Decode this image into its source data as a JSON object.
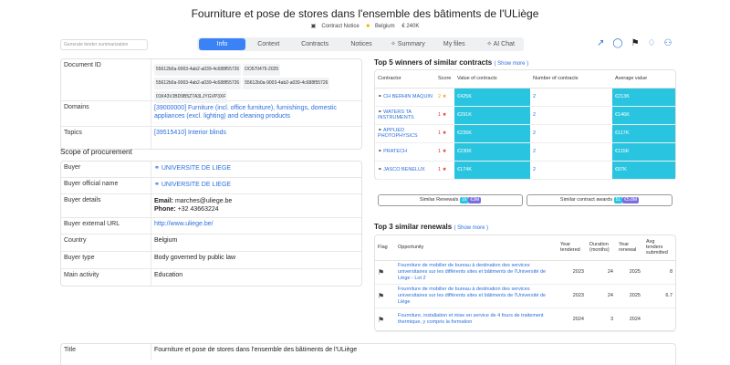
{
  "header": {
    "title": "Fourniture et pose de stores dans l'ensemble des bâtiments de l'ULiège",
    "notice_type": "Contract Notice",
    "country": "Belgium",
    "value": "€ 240K"
  },
  "search": {
    "placeholder": "Generate tender summarization"
  },
  "tabs": [
    {
      "label": "Info",
      "active": true
    },
    {
      "label": "Context"
    },
    {
      "label": "Contracts"
    },
    {
      "label": "Notices"
    },
    {
      "label": "Summary",
      "icon": "sparkle-icon"
    },
    {
      "label": "My files"
    },
    {
      "label": "AI Chat",
      "icon": "sparkle-icon"
    }
  ],
  "toolbar_icons": [
    "share-icon",
    "comment-icon",
    "flag-icon",
    "bell-icon",
    "add-user-icon"
  ],
  "details": {
    "document_id": {
      "label": "Document ID",
      "chips": [
        "55612b0a-9003-4ab2-a039-4c688f55726",
        "DO570475-2025",
        "55612b0a-9003-4ab2-a039-4c688f55726",
        "55612b0a-9003-4ab2-a039-4c688f55726",
        "01K43VJBD9B5Z7A3LJYGVP3XF"
      ]
    },
    "domains": {
      "label": "Domains",
      "value": "[39000000] Furniture (incl. office furniture), furnishings, domestic appliances (excl. lighting) and cleaning products"
    },
    "topics": {
      "label": "Topics",
      "value": "[39515410] Interior blinds"
    }
  },
  "scope": {
    "heading": "Scope of procurement",
    "buyer": {
      "label": "Buyer",
      "value": "UNIVERSITE DE LIEGE"
    },
    "buyer_official": {
      "label": "Buyer official name",
      "value": "UNIVERSITE DE LIEGE"
    },
    "buyer_details": {
      "label": "Buyer details",
      "email_label": "Email:",
      "email": "marches@uliege.be",
      "phone_label": "Phone:",
      "phone": "+32 43663224"
    },
    "buyer_url": {
      "label": "Buyer external URL",
      "value": "http://www.uliege.be/"
    },
    "country": {
      "label": "Country",
      "value": "Belgium"
    },
    "buyer_type": {
      "label": "Buyer type",
      "value": "Body governed by public law"
    },
    "main_activity": {
      "label": "Main activity",
      "value": "Education"
    }
  },
  "title_row": {
    "label": "Title",
    "value": "Fourniture et pose de stores dans l'ensemble des bâtiments de l'ULiège"
  },
  "winners": {
    "heading": "Top 5 winners of similar contracts",
    "show_more": "( Show more )",
    "columns": [
      "Contractor",
      "Score",
      "Value of contracts",
      "Number of contracts",
      "Average value"
    ],
    "rows": [
      {
        "name": "CH BERHIN MAQUIN",
        "score": "2",
        "value": "€425K",
        "count": "2",
        "avg": "€213K"
      },
      {
        "name": "WATERS TA INSTRUMENTS",
        "score": "1",
        "value": "€291K",
        "count": "2",
        "avg": "€146K"
      },
      {
        "name": "APPLIED PHOTOPHYSICS",
        "score": "1",
        "value": "€235K",
        "count": "2",
        "avg": "€117K"
      },
      {
        "name": "PRATECH",
        "score": "1",
        "value": "€230K",
        "count": "2",
        "avg": "€115K"
      },
      {
        "name": "JASCO BENELUX",
        "score": "1",
        "value": "€174K",
        "count": "2",
        "avg": "€87K"
      }
    ],
    "similar_renewals": {
      "label": "Similar Renewals",
      "count": "16",
      "value": "€3M"
    },
    "similar_awards": {
      "label": "Similar contract awards",
      "count": "51",
      "value": "€5.8M"
    }
  },
  "renewals": {
    "heading": "Top 3 similar renewals",
    "show_more": "( Show more )",
    "columns": [
      "Flag",
      "Opportunity",
      "Year tendered",
      "Duration (months)",
      "Year renewal",
      "Avg tenders submitted"
    ],
    "rows": [
      {
        "opp": "Fourniture de mobilier de bureau à destination des services universitaires sur les différents sites et bâtiments de l'Université de Liège - Lot 2",
        "year": "2023",
        "dur": "24",
        "renew": "2025",
        "avg": "8"
      },
      {
        "opp": "Fourniture de mobilier de bureau à destination des services universitaires sur les différents sites et bâtiments de l'Université de Liège",
        "year": "2023",
        "dur": "24",
        "renew": "2025",
        "avg": "6.7"
      },
      {
        "opp": "Fourniture, installation et mise en service de 4 fours de traitement thermique, y compris la formation",
        "year": "2024",
        "dur": "3",
        "renew": "2024",
        "avg": ""
      }
    ]
  },
  "colors": {
    "accent": "#3b82f6",
    "cyan": "#29c4e0",
    "link": "#2a6fdb",
    "gold": "#f0a020",
    "red": "#e03030"
  }
}
